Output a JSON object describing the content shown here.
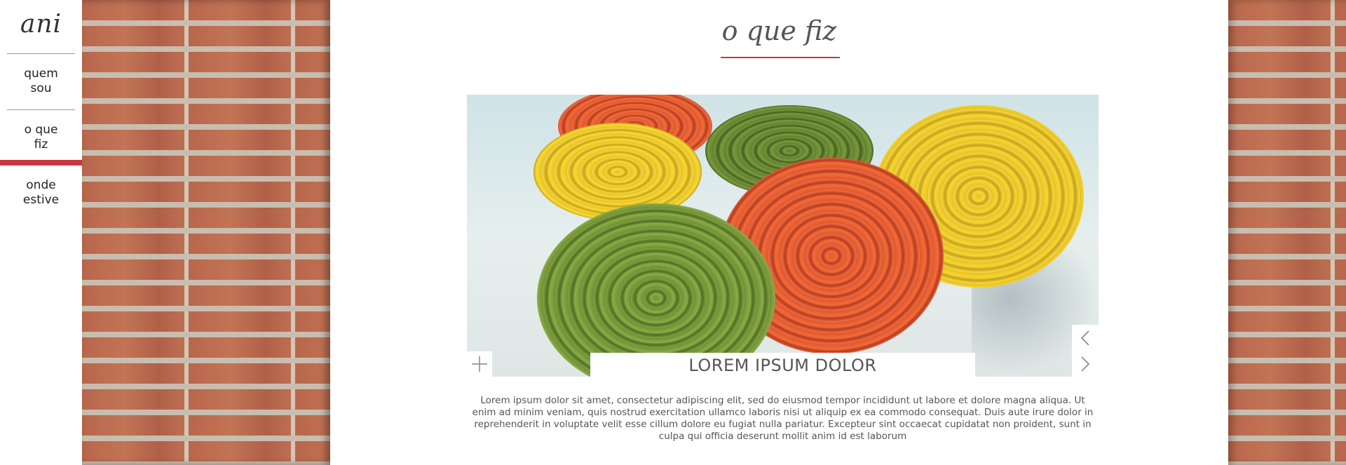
{
  "sidebar": {
    "logo": "ani",
    "items": [
      {
        "label": "quem sou"
      },
      {
        "label": "o que fiz",
        "active": true
      },
      {
        "label": "onde estive"
      }
    ]
  },
  "main": {
    "page_title": "o que fiz",
    "slide": {
      "caption": "LOREM IPSUM DOLOR",
      "description": "Lorem ipsum dolor sit amet, consectetur adipiscing elit, sed do eiusmod tempor incididunt ut labore et dolore magna aliqua. Ut enim ad minim veniam, quis nostrud exercitation ullamco laboris nisi ut aliquip ex ea commodo consequat. Duis aute irure dolor in reprehenderit in voluptate velit esse cillum dolore eu fugiat nulla pariatur. Excepteur sint occaecat cupidatat non proident, sunt in culpa qui officia deserunt mollit anim id est laborum"
    },
    "icons": {
      "expand": "plus-icon",
      "prev": "chevron-left-icon",
      "next": "chevron-right-icon"
    }
  },
  "colors": {
    "accent": "#c7383e",
    "text": "#555555",
    "panel": "#ffffff"
  }
}
